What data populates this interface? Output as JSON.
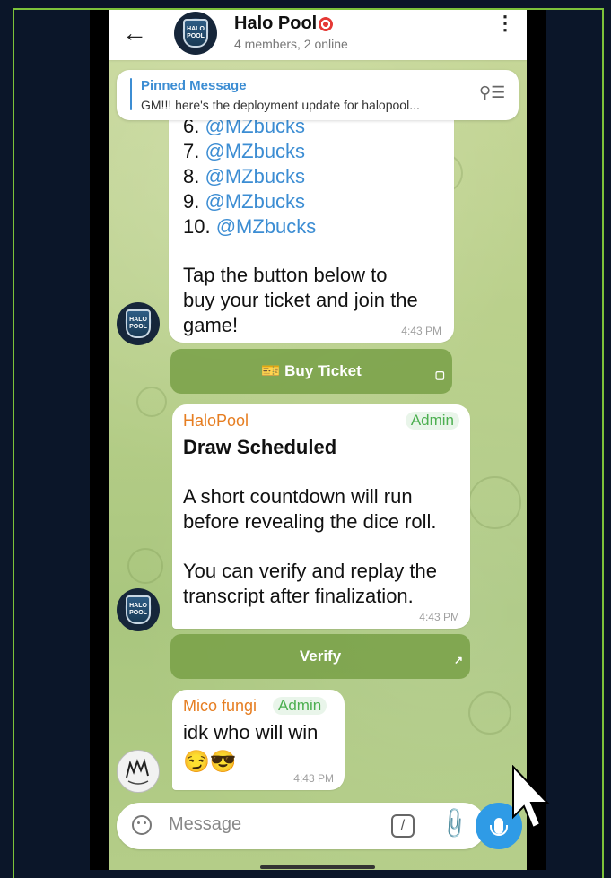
{
  "header": {
    "back_icon": "arrow-left-icon",
    "title": "Halo Pool",
    "subtitle": "4 members, 2 online",
    "menu_icon": "kebab-menu-icon"
  },
  "pinned": {
    "title": "Pinned Message",
    "text": "GM!!! here's the deployment update for halopool...",
    "icon": "unpin-list-icon"
  },
  "messages": {
    "m1": {
      "list": [
        {
          "num": "6.",
          "user": "@MZbucks"
        },
        {
          "num": "7.",
          "user": "@MZbucks"
        },
        {
          "num": "8.",
          "user": "@MZbucks"
        },
        {
          "num": "9.",
          "user": "@MZbucks"
        },
        {
          "num": "10.",
          "user": "@MZbucks"
        }
      ],
      "line1": "Tap the button below to",
      "line2": "buy your ticket and join the",
      "line3": "game!",
      "time": "4:43 PM",
      "button": "🎫 Buy Ticket"
    },
    "m2": {
      "sender": "HaloPool",
      "badge": "Admin",
      "title": "Draw Scheduled",
      "p1_line1": "A short countdown will run",
      "p1_line2": "before revealing the dice roll.",
      "p2_line1": "You can verify and replay the",
      "p2_line2": "transcript after finalization.",
      "time": "4:43 PM",
      "button": "Verify"
    },
    "m3": {
      "sender": "Mico fungi",
      "badge": "Admin",
      "text": "idk who will win",
      "emojis": "😏😎",
      "time": "4:43 PM"
    }
  },
  "input": {
    "placeholder": "Message"
  },
  "colors": {
    "accent": "#3c8dd3",
    "admin": "#4caf50",
    "sender": "#e67e22",
    "frame": "#7cc23a"
  }
}
